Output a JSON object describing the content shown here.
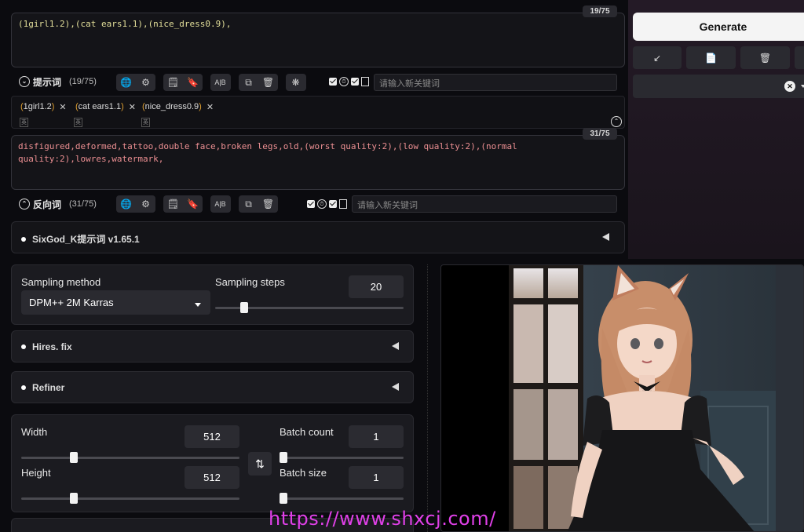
{
  "positive_prompt": {
    "text": "(1girl1.2),(cat ears1.1),(nice_dress0.9),",
    "token_count": "19/75"
  },
  "positive_toolbar": {
    "label": "提示词",
    "count": "(19/75)",
    "keyword_placeholder": "请输入新关键词"
  },
  "tags": [
    {
      "text": "1girl1.2",
      "sub": "英"
    },
    {
      "text": "cat ears1.1",
      "sub": "英"
    },
    {
      "text": "nice_dress0.9",
      "sub": "英"
    }
  ],
  "negative_prompt": {
    "text": "disfigured,deformed,tattoo,double face,broken legs,old,(worst quality:2),(low quality:2),(normal quality:2),lowres,watermark,",
    "token_count": "31/75"
  },
  "negative_toolbar": {
    "label": "反向词",
    "count": "(31/75)",
    "keyword_placeholder": "请输入新关键词"
  },
  "extension": {
    "title": "SixGod_K提示词 v1.65.1"
  },
  "sampling": {
    "method_label": "Sampling method",
    "method_value": "DPM++ 2M Karras",
    "steps_label": "Sampling steps",
    "steps_value": "20",
    "steps_fraction": 0.14
  },
  "hires": {
    "title": "Hires. fix"
  },
  "refiner": {
    "title": "Refiner"
  },
  "dimensions": {
    "width_label": "Width",
    "width_value": "512",
    "height_label": "Height",
    "height_value": "512",
    "batch_count_label": "Batch count",
    "batch_count_value": "1",
    "batch_size_label": "Batch size",
    "batch_size_value": "1"
  },
  "generate": {
    "label": "Generate"
  },
  "watermark": "https://www.shxcj.com/",
  "colors": {
    "accent": "#f4f4f4",
    "background": "#0b0b0f",
    "positive_text": "#e3df9a",
    "negative_text": "#ec8f92"
  }
}
